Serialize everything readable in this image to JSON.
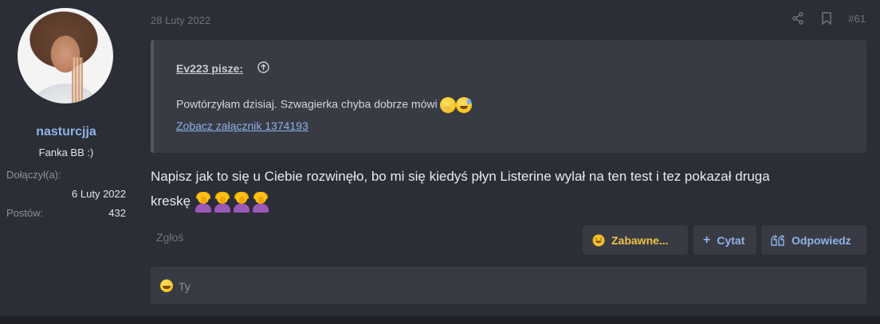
{
  "user": {
    "name": "nasturcjja",
    "title": "Fanka BB :)",
    "joined_label": "Dołączył(a):",
    "joined_value": "6 Luty 2022",
    "posts_label": "Postów:",
    "posts_value": "432"
  },
  "post": {
    "date": "28 Luty 2022",
    "number": "#61",
    "body_line1": "Napisz jak to się u Ciebie rozwinęło, bo mi się kiedyś płyn Listerine wylał na ten test i tez pokazał druga",
    "body_line2": "kreskę",
    "body_emoji": [
      "woman-facepalming",
      "woman-facepalming",
      "woman-facepalming",
      "woman-facepalming"
    ]
  },
  "quote": {
    "author": "Ev223 pisze:",
    "text": "Powtórzyłam dzisiaj. Szwagierka chyba dobrze mówi",
    "emoji": [
      "thinking-face-icon",
      "grinning-sweat-icon"
    ],
    "attachment_link": "Zobacz załącznik 1374193"
  },
  "actions": {
    "report": "Zgłoś",
    "react": "Zabawne...",
    "quote": "Cytat",
    "reply": "Odpowiedz"
  },
  "reactions": {
    "text": "Ty"
  },
  "colors": {
    "background": "#2b2e36",
    "panel": "#383b44",
    "link": "#8fb2e6",
    "react": "#f0c246"
  }
}
